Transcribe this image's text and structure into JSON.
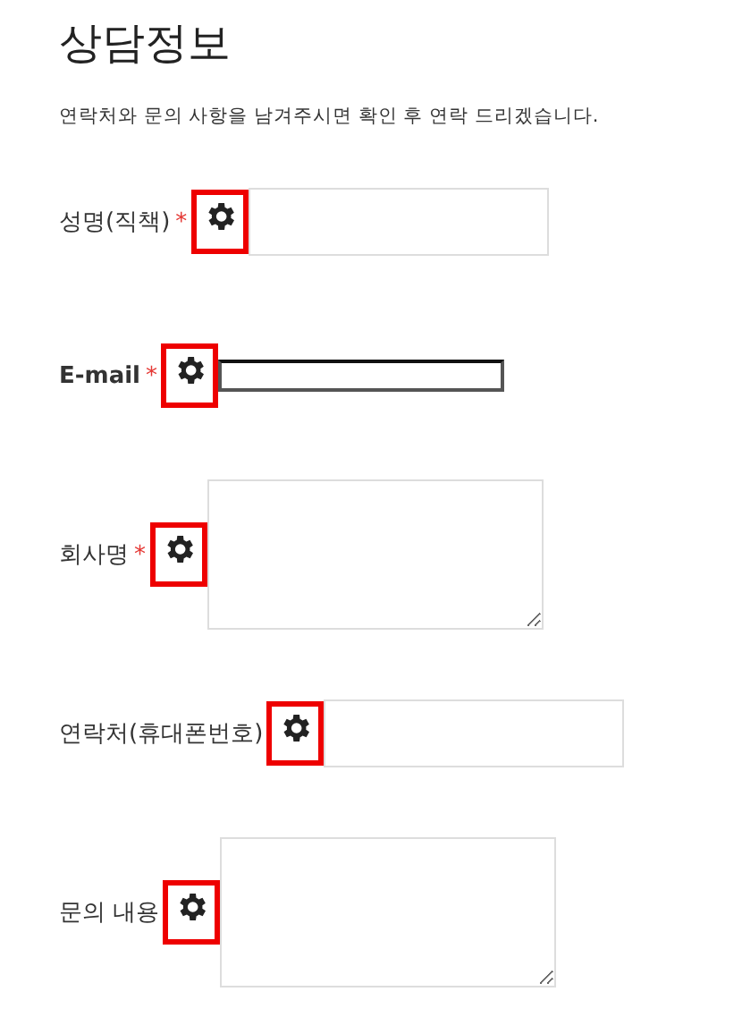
{
  "title": "상담정보",
  "intro": "연락처와 문의 사항을 남겨주시면 확인 후 연락 드리겠습니다.",
  "fields": [
    {
      "label": "성명(직책)",
      "required_mark": "*",
      "kind": "input",
      "focused": false
    },
    {
      "label": "E-mail",
      "required_mark": "*",
      "kind": "input",
      "focused": true
    },
    {
      "label": "회사명",
      "required_mark": "*",
      "kind": "textarea",
      "focused": false
    },
    {
      "label": "연락처(휴대폰번호)",
      "kind": "input",
      "focused": false
    },
    {
      "label": "문의 내용",
      "kind": "textarea",
      "focused": false
    }
  ]
}
